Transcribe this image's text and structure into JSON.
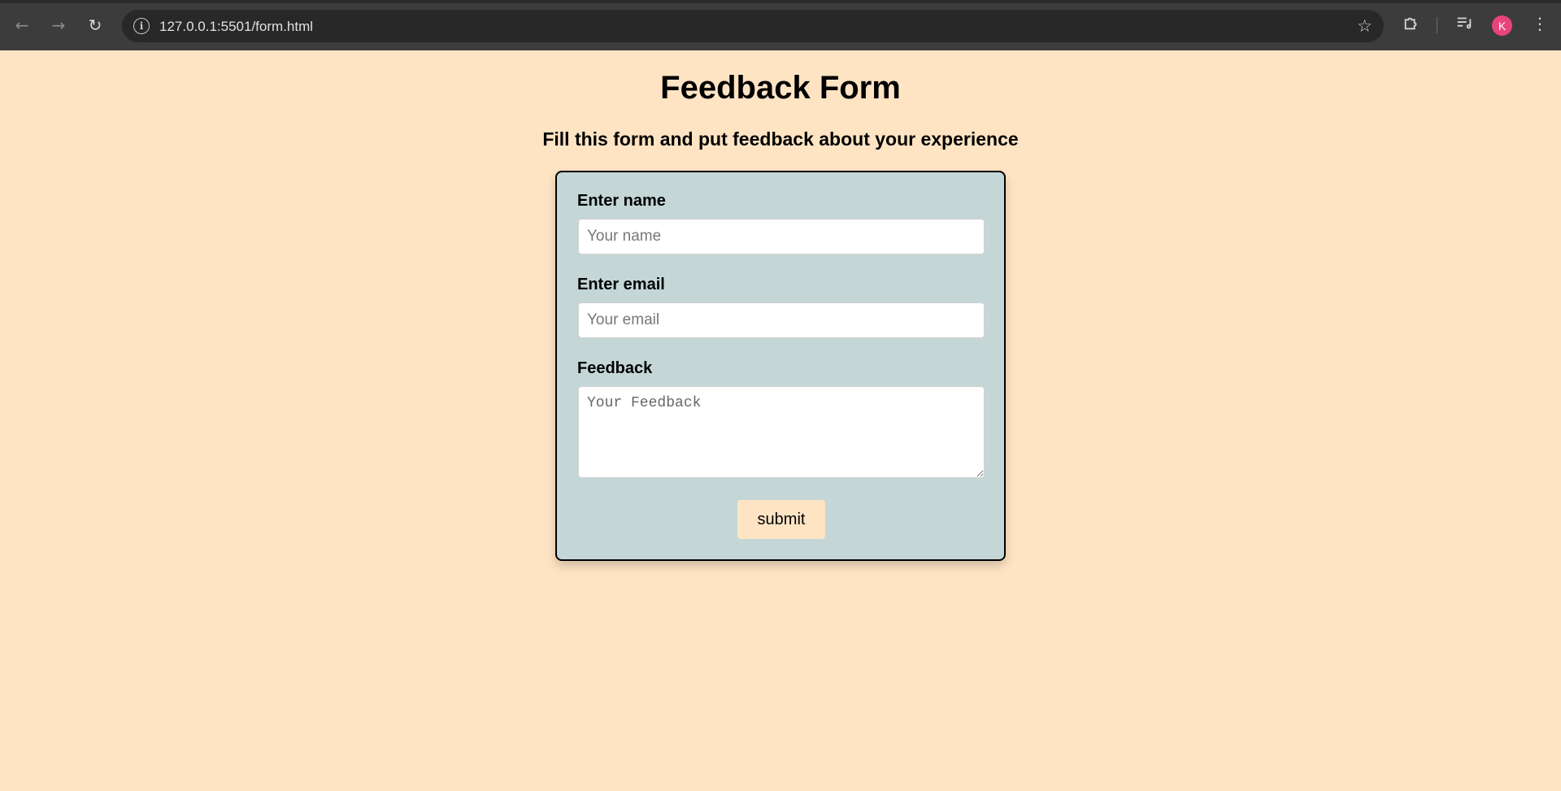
{
  "browser": {
    "url": "127.0.0.1:5501/form.html",
    "avatar_initial": "K",
    "icons": {
      "back": "back-arrow-icon",
      "forward": "forward-arrow-icon",
      "reload": "reload-icon",
      "info": "site-info-icon",
      "bookmark": "bookmark-star-icon",
      "extensions": "extensions-puzzle-icon",
      "media": "media-controls-icon",
      "menu": "kebab-menu-icon"
    }
  },
  "page": {
    "title": "Feedback Form",
    "subtitle": "Fill this form and put feedback about your experience"
  },
  "form": {
    "name_label": "Enter name",
    "name_placeholder": "Your name",
    "email_label": "Enter email",
    "email_placeholder": "Your email",
    "feedback_label": "Feedback",
    "feedback_placeholder": "Your Feedback",
    "submit_label": "submit"
  },
  "colors": {
    "page_background": "#FFE4C4",
    "card_background": "#C4D7D6",
    "button_background": "#FFE4C4",
    "avatar": "#E8447A"
  }
}
